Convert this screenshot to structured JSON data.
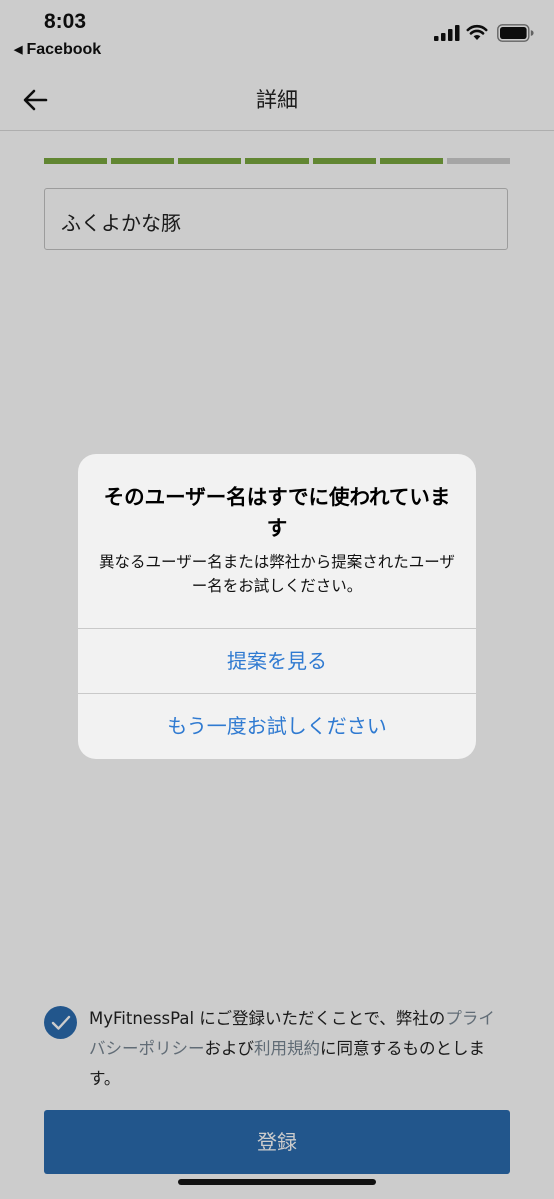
{
  "status_bar": {
    "time": "8:03",
    "back_app": "Facebook",
    "icons": [
      "cellular-signal-icon",
      "wifi-icon",
      "battery-icon"
    ]
  },
  "nav": {
    "title": "詳細",
    "back_icon": "arrow-left-icon"
  },
  "progress": {
    "completed_steps": 6,
    "total_steps": 7,
    "active_color": "#7aa83f",
    "inactive_color": "#cfcfcf"
  },
  "username_field": {
    "value": "ふくよかな豚"
  },
  "alert": {
    "title": "そのユーザー名はすでに使われています",
    "message": "異なるユーザー名または弊社から提案されたユーザー名をお試しください。",
    "buttons": [
      {
        "label": "提案を見る"
      },
      {
        "label": "もう一度お試しください"
      }
    ]
  },
  "consent": {
    "checked": true,
    "text_before": "MyFitnessPal にご登録いただくことで、弊社の",
    "privacy_link": "プライバシーポリシー",
    "text_middle": "および",
    "terms_link": "利用規約",
    "text_after": "に同意するものとします。"
  },
  "register_button": {
    "label": "登録"
  },
  "colors": {
    "accent_blue": "#2b6cb0",
    "alert_button_blue": "#2f7ad1",
    "progress_green": "#7aa83f"
  }
}
